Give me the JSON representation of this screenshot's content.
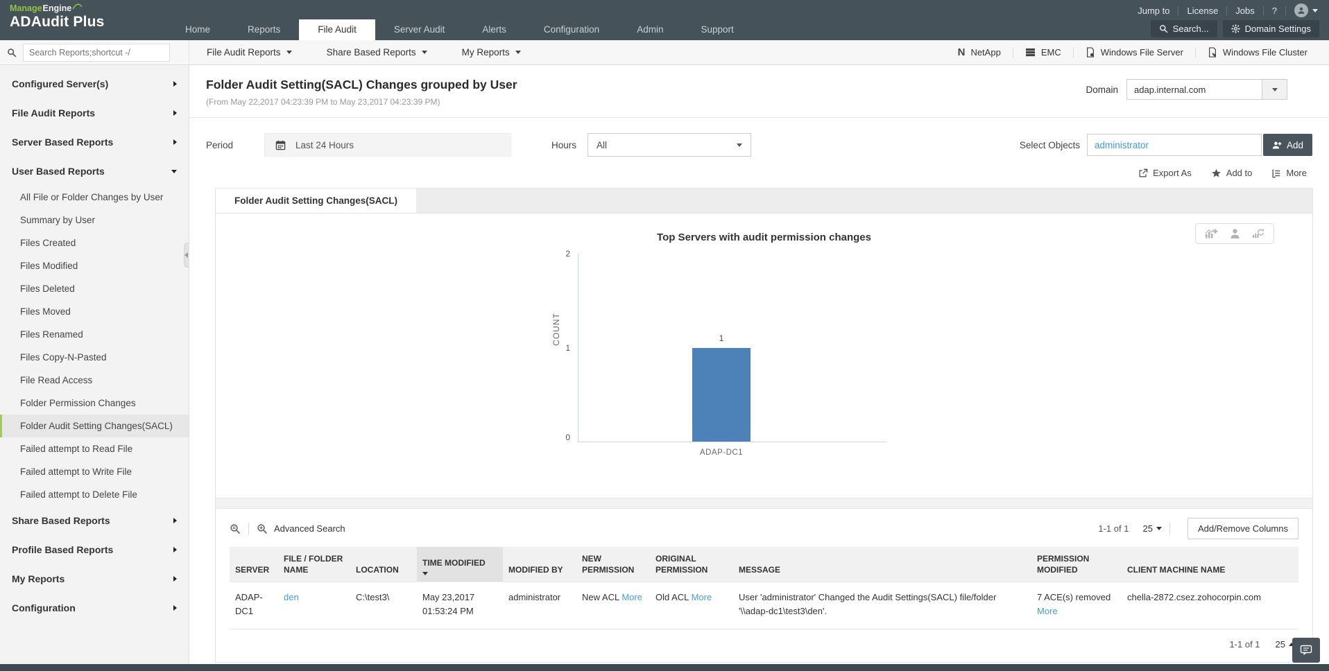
{
  "brand": {
    "manage": "Manage",
    "engine": "Engine",
    "product": "ADAudit Plus"
  },
  "topnav": {
    "tabs": [
      "Home",
      "Reports",
      "File Audit",
      "Server Audit",
      "Alerts",
      "Configuration",
      "Admin",
      "Support"
    ],
    "active_tab": "File Audit",
    "jump_to": "Jump to",
    "license": "License",
    "jobs": "Jobs",
    "help": "?",
    "search_button": "Search...",
    "domain_settings": "Domain Settings"
  },
  "toolbar": {
    "search_placeholder": "Search Reports;shortcut -/",
    "menus": [
      "File Audit Reports",
      "Share Based Reports",
      "My Reports"
    ],
    "netapp_icon": "N",
    "server_links": [
      "NetApp",
      "EMC",
      "Windows File Server",
      "Windows File Cluster"
    ]
  },
  "sidebar": {
    "groups_top": [
      "Configured Server(s)",
      "File Audit Reports",
      "Server Based Reports"
    ],
    "user_based_label": "User Based Reports",
    "user_based_items": [
      "All File or Folder Changes by User",
      "Summary by User",
      "Files Created",
      "Files Modified",
      "Files Deleted",
      "Files Moved",
      "Files Renamed",
      "Files Copy-N-Pasted",
      "File Read Access",
      "Folder Permission Changes",
      "Folder Audit Setting Changes(SACL)",
      "Failed attempt to Read File",
      "Failed attempt to Write File",
      "Failed attempt to Delete File"
    ],
    "selected_item": "Folder Audit Setting Changes(SACL)",
    "groups_bottom": [
      "Share Based Reports",
      "Profile Based Reports",
      "My Reports",
      "Configuration"
    ]
  },
  "report": {
    "title": "Folder Audit Setting(SACL) Changes grouped by User",
    "subtitle": "(From May 22,2017 04:23:39 PM to May 23,2017 04:23:39 PM)",
    "domain_label": "Domain",
    "domain_value": "adap.internal.com",
    "tab_label": "Folder Audit Setting Changes(SACL)"
  },
  "filters": {
    "period_label": "Period",
    "period_value": "Last 24 Hours",
    "hours_label": "Hours",
    "hours_value": "All",
    "select_objects_label": "Select Objects",
    "select_objects_value": "administrator",
    "add_button": "Add"
  },
  "actions": {
    "export_as": "Export As",
    "add_to": "Add to",
    "more": "More"
  },
  "chart_data": {
    "type": "bar",
    "title": "Top Servers with audit permission changes",
    "categories": [
      "ADAP-DC1"
    ],
    "values": [
      1
    ],
    "value_labels": [
      "1"
    ],
    "xlabel": "",
    "ylabel": "COUNT",
    "ylim": [
      0,
      2
    ],
    "yticks": [
      0,
      1,
      2
    ],
    "grid": false,
    "legend": "none",
    "bar_color": "#4d82b8"
  },
  "table": {
    "advanced_search_label": "Advanced Search",
    "columns": [
      "SERVER",
      "FILE / FOLDER NAME",
      "LOCATION",
      "TIME MODIFIED",
      "MODIFIED BY",
      "NEW PERMISSION",
      "ORIGINAL PERMISSION",
      "MESSAGE",
      "PERMISSION MODIFIED",
      "CLIENT MACHINE NAME"
    ],
    "sorted_column": "TIME MODIFIED",
    "sort_direction": "desc",
    "rows": [
      {
        "server": "ADAP-DC1",
        "file_folder_name": "den",
        "location": "C:\\test3\\",
        "time_modified": "May 23,2017 01:53:24 PM",
        "modified_by": "administrator",
        "new_permission": "New ACL",
        "new_permission_link": "More",
        "original_permission": "Old ACL",
        "original_permission_link": "More",
        "message": "User 'administrator' Changed the Audit Settings(SACL) file/folder '\\\\adap-dc1\\test3\\den'.",
        "permission_modified": "7 ACE(s) removed",
        "permission_modified_link": "More",
        "client_machine_name": "chella-2872.csez.zohocorpin.com"
      }
    ],
    "pagination": {
      "range": "1-1 of 1",
      "page_size": "25"
    },
    "add_remove_columns": "Add/Remove Columns"
  }
}
